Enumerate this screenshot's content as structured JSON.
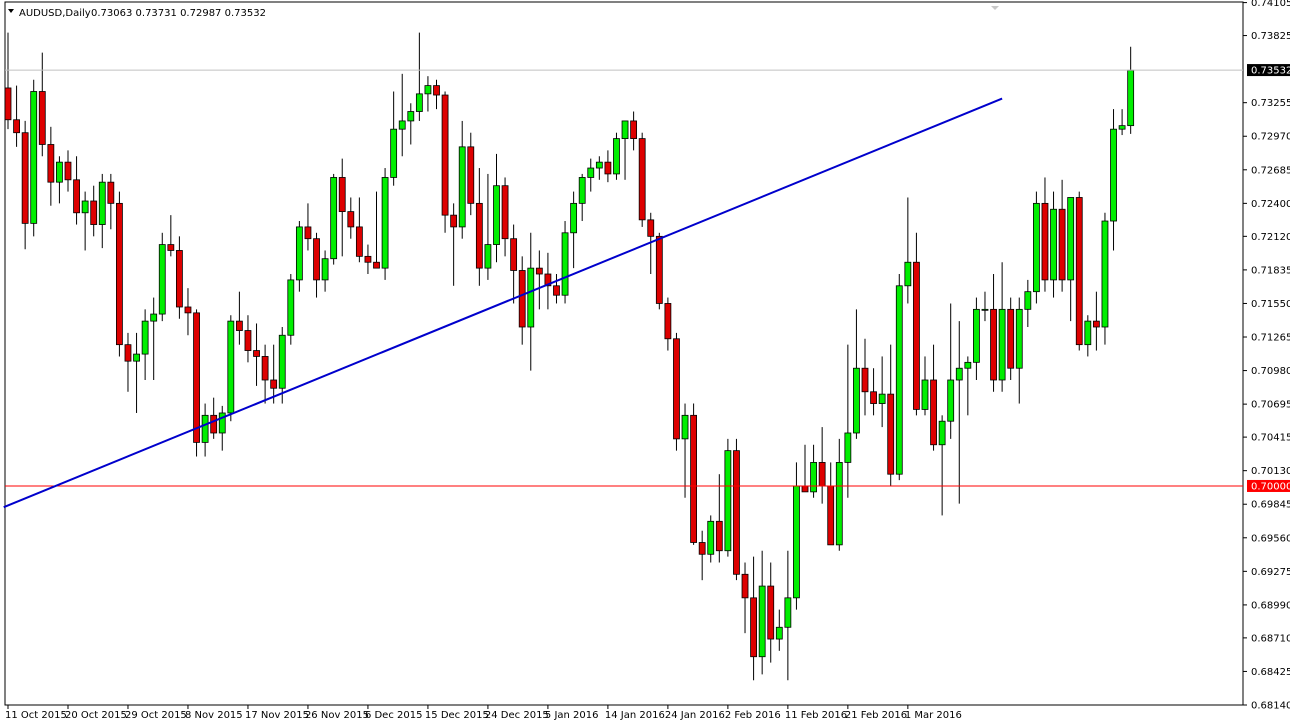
{
  "header": {
    "symbol_label": "AUDUSD,Daily",
    "ohlc_text": "0.73063 0.73731 0.72987 0.73532"
  },
  "colors": {
    "bull": "#00ee00",
    "bear": "#dd0000",
    "trendline": "#0000cc",
    "level_line": "#ff0000",
    "current_tag": "#000000"
  },
  "chart_data": {
    "type": "candlestick",
    "symbol": "AUDUSD",
    "timeframe": "Daily",
    "ylim": [
      0.6814,
      0.7411
    ],
    "y_ticks": [
      "0.74105",
      "0.73825",
      "0.73255",
      "0.72970",
      "0.72685",
      "0.72400",
      "0.72120",
      "0.71835",
      "0.71550",
      "0.71265",
      "0.70980",
      "0.70695",
      "0.70415",
      "0.70130",
      "0.69845",
      "0.69560",
      "0.69275",
      "0.68990",
      "0.68710",
      "0.68425",
      "0.68140"
    ],
    "x_labels": [
      {
        "label": "11 Oct 2015",
        "index": 0
      },
      {
        "label": "20 Oct 2015",
        "index": 7
      },
      {
        "label": "29 Oct 2015",
        "index": 14
      },
      {
        "label": "8 Nov 2015",
        "index": 21
      },
      {
        "label": "17 Nov 2015",
        "index": 28
      },
      {
        "label": "26 Nov 2015",
        "index": 35
      },
      {
        "label": "6 Dec 2015",
        "index": 42
      },
      {
        "label": "15 Dec 2015",
        "index": 49
      },
      {
        "label": "24 Dec 2015",
        "index": 56
      },
      {
        "label": "5 Jan 2016",
        "index": 63
      },
      {
        "label": "14 Jan 2016",
        "index": 70
      },
      {
        "label": "24 Jan 2016",
        "index": 77
      },
      {
        "label": "2 Feb 2016",
        "index": 84
      },
      {
        "label": "11 Feb 2016",
        "index": 91
      },
      {
        "label": "21 Feb 2016",
        "index": 98
      },
      {
        "label": "1 Mar 2016",
        "index": 105
      }
    ],
    "current_price": {
      "value": 0.73532,
      "label": "0.73532"
    },
    "horizontal_level": {
      "value": 0.7,
      "label": "0.70000"
    },
    "trendline": {
      "from": {
        "index": -0.5,
        "price": 0.6982
      },
      "to": {
        "index": 116,
        "price": 0.7329
      }
    },
    "candles": [
      [
        0.7338,
        0.7385,
        0.7303,
        0.7311
      ],
      [
        0.7311,
        0.734,
        0.7288,
        0.73
      ],
      [
        0.73,
        0.731,
        0.7201,
        0.7223
      ],
      [
        0.7223,
        0.7345,
        0.7212,
        0.7335
      ],
      [
        0.7335,
        0.7368,
        0.728,
        0.729
      ],
      [
        0.729,
        0.7305,
        0.7238,
        0.7258
      ],
      [
        0.7258,
        0.728,
        0.724,
        0.7275
      ],
      [
        0.7275,
        0.7285,
        0.725,
        0.726
      ],
      [
        0.726,
        0.728,
        0.7222,
        0.7232
      ],
      [
        0.7232,
        0.725,
        0.72,
        0.7242
      ],
      [
        0.7242,
        0.7255,
        0.7212,
        0.7222
      ],
      [
        0.7222,
        0.7265,
        0.7202,
        0.7258
      ],
      [
        0.7258,
        0.7265,
        0.7218,
        0.724
      ],
      [
        0.724,
        0.725,
        0.711,
        0.712
      ],
      [
        0.712,
        0.713,
        0.708,
        0.7106
      ],
      [
        0.7106,
        0.713,
        0.7062,
        0.7112
      ],
      [
        0.7112,
        0.715,
        0.709,
        0.714
      ],
      [
        0.714,
        0.716,
        0.709,
        0.7146
      ],
      [
        0.7146,
        0.7215,
        0.714,
        0.7205
      ],
      [
        0.7205,
        0.723,
        0.7195,
        0.72
      ],
      [
        0.72,
        0.7212,
        0.7142,
        0.7152
      ],
      [
        0.7152,
        0.7168,
        0.7128,
        0.7147
      ],
      [
        0.7147,
        0.715,
        0.7025,
        0.7037
      ],
      [
        0.7037,
        0.707,
        0.7025,
        0.706
      ],
      [
        0.706,
        0.7075,
        0.704,
        0.7045
      ],
      [
        0.7045,
        0.7068,
        0.703,
        0.7062
      ],
      [
        0.7062,
        0.7145,
        0.7055,
        0.714
      ],
      [
        0.714,
        0.7165,
        0.712,
        0.7132
      ],
      [
        0.7132,
        0.7145,
        0.7105,
        0.7115
      ],
      [
        0.7115,
        0.7138,
        0.7085,
        0.711
      ],
      [
        0.711,
        0.712,
        0.707,
        0.709
      ],
      [
        0.709,
        0.712,
        0.707,
        0.7083
      ],
      [
        0.7083,
        0.7135,
        0.707,
        0.7128
      ],
      [
        0.7128,
        0.718,
        0.712,
        0.7175
      ],
      [
        0.7175,
        0.7225,
        0.7165,
        0.722
      ],
      [
        0.722,
        0.724,
        0.72,
        0.721
      ],
      [
        0.721,
        0.7215,
        0.716,
        0.7175
      ],
      [
        0.7175,
        0.72,
        0.7165,
        0.7193
      ],
      [
        0.7193,
        0.7265,
        0.7188,
        0.7262
      ],
      [
        0.7262,
        0.7278,
        0.7195,
        0.7233
      ],
      [
        0.7233,
        0.7245,
        0.721,
        0.722
      ],
      [
        0.722,
        0.7245,
        0.719,
        0.7195
      ],
      [
        0.7195,
        0.7205,
        0.718,
        0.719
      ],
      [
        0.719,
        0.725,
        0.7185,
        0.7185
      ],
      [
        0.7185,
        0.727,
        0.7175,
        0.7262
      ],
      [
        0.7262,
        0.7335,
        0.7255,
        0.7303
      ],
      [
        0.7303,
        0.735,
        0.728,
        0.731
      ],
      [
        0.731,
        0.7325,
        0.729,
        0.7318
      ],
      [
        0.7318,
        0.7385,
        0.731,
        0.7333
      ],
      [
        0.7333,
        0.7348,
        0.7318,
        0.734
      ],
      [
        0.734,
        0.7345,
        0.732,
        0.7332
      ],
      [
        0.7332,
        0.7335,
        0.7215,
        0.723
      ],
      [
        0.723,
        0.724,
        0.717,
        0.722
      ],
      [
        0.722,
        0.731,
        0.721,
        0.7288
      ],
      [
        0.7288,
        0.73,
        0.723,
        0.724
      ],
      [
        0.724,
        0.727,
        0.717,
        0.7185
      ],
      [
        0.7185,
        0.7265,
        0.7175,
        0.7205
      ],
      [
        0.7205,
        0.7282,
        0.719,
        0.7255
      ],
      [
        0.7255,
        0.7262,
        0.7195,
        0.721
      ],
      [
        0.721,
        0.7222,
        0.7155,
        0.7183
      ],
      [
        0.7183,
        0.7195,
        0.712,
        0.7135
      ],
      [
        0.7135,
        0.7215,
        0.7098,
        0.7185
      ],
      [
        0.7185,
        0.72,
        0.715,
        0.718
      ],
      [
        0.718,
        0.7198,
        0.715,
        0.717
      ],
      [
        0.717,
        0.718,
        0.7155,
        0.7162
      ]
    ],
    "candles2": [
      [
        0.7162,
        0.7225,
        0.7155,
        0.7215
      ],
      [
        0.7215,
        0.725,
        0.7185,
        0.724
      ],
      [
        0.724,
        0.7265,
        0.7225,
        0.7262
      ],
      [
        0.7262,
        0.7278,
        0.725,
        0.727
      ],
      [
        0.727,
        0.728,
        0.726,
        0.7275
      ],
      [
        0.7275,
        0.7285,
        0.7258,
        0.7265
      ],
      [
        0.7265,
        0.73,
        0.726,
        0.7295
      ],
      [
        0.7295,
        0.7308,
        0.726,
        0.731
      ],
      [
        0.731,
        0.7318,
        0.7285,
        0.7295
      ],
      [
        0.7295,
        0.73,
        0.722,
        0.7226
      ],
      [
        0.7226,
        0.7232,
        0.718,
        0.7212
      ],
      [
        0.7212,
        0.7215,
        0.715,
        0.7155
      ],
      [
        0.7155,
        0.716,
        0.7115,
        0.7125
      ],
      [
        0.7125,
        0.713,
        0.703,
        0.704
      ],
      [
        0.704,
        0.707,
        0.699,
        0.706
      ],
      [
        0.706,
        0.707,
        0.695,
        0.6952
      ],
      [
        0.6952,
        0.6962,
        0.692,
        0.6942
      ],
      [
        0.6942,
        0.6975,
        0.6935,
        0.697
      ],
      [
        0.697,
        0.701,
        0.6935,
        0.6945
      ],
      [
        0.6945,
        0.704,
        0.694,
        0.703
      ],
      [
        0.703,
        0.704,
        0.692,
        0.6925
      ],
      [
        0.6925,
        0.6935,
        0.6875,
        0.6905
      ],
      [
        0.6905,
        0.694,
        0.6835,
        0.6855
      ],
      [
        0.6855,
        0.6945,
        0.684,
        0.6915
      ],
      [
        0.6915,
        0.6935,
        0.685,
        0.687
      ],
      [
        0.687,
        0.6895,
        0.686,
        0.688
      ],
      [
        0.688,
        0.6945,
        0.6835,
        0.6905
      ],
      [
        0.6905,
        0.702,
        0.6895,
        0.7
      ],
      [
        0.7,
        0.7035,
        0.6995,
        0.6995
      ],
      [
        0.6995,
        0.7035,
        0.699,
        0.702
      ],
      [
        0.702,
        0.705,
        0.6985,
        0.7
      ],
      [
        0.7,
        0.702,
        0.695,
        0.695
      ],
      [
        0.695,
        0.704,
        0.6945,
        0.702
      ],
      [
        0.702,
        0.712,
        0.699,
        0.7045
      ],
      [
        0.7045,
        0.715,
        0.704,
        0.71
      ],
      [
        0.71,
        0.7125,
        0.706,
        0.708
      ],
      [
        0.708,
        0.71,
        0.706,
        0.707
      ],
      [
        0.707,
        0.711,
        0.705,
        0.7078
      ],
      [
        0.7078,
        0.712,
        0.7,
        0.701
      ],
      [
        0.701,
        0.718,
        0.7005,
        0.717
      ],
      [
        0.717,
        0.7245,
        0.7155,
        0.719
      ],
      [
        0.719,
        0.7215,
        0.706,
        0.7065
      ],
      [
        0.7065,
        0.711,
        0.706,
        0.709
      ],
      [
        0.709,
        0.712,
        0.703,
        0.7035
      ],
      [
        0.7035,
        0.706,
        0.6975,
        0.7055
      ],
      [
        0.7055,
        0.7155,
        0.704,
        0.709
      ],
      [
        0.709,
        0.714,
        0.6985,
        0.71
      ],
      [
        0.71,
        0.711,
        0.706,
        0.7105
      ],
      [
        0.7105,
        0.716,
        0.709,
        0.715
      ],
      [
        0.715,
        0.7165,
        0.714,
        0.715
      ],
      [
        0.715,
        0.718,
        0.708,
        0.709
      ],
      [
        0.709,
        0.719,
        0.708,
        0.715
      ],
      [
        0.715,
        0.716,
        0.709,
        0.71
      ],
      [
        0.71,
        0.716,
        0.707,
        0.715
      ],
      [
        0.715,
        0.7175,
        0.7135,
        0.7165
      ],
      [
        0.7165,
        0.725,
        0.7155,
        0.724
      ],
      [
        0.724,
        0.7262,
        0.7165,
        0.7175
      ],
      [
        0.7175,
        0.725,
        0.716,
        0.7235
      ],
      [
        0.7235,
        0.726,
        0.7165,
        0.7175
      ],
      [
        0.7175,
        0.7245,
        0.714,
        0.7245
      ],
      [
        0.7245,
        0.725,
        0.7115,
        0.712
      ],
      [
        0.712,
        0.7145,
        0.711,
        0.714
      ],
      [
        0.714,
        0.7165,
        0.7115,
        0.7135
      ],
      [
        0.7135,
        0.7232,
        0.712,
        0.7225
      ],
      [
        0.7225,
        0.732,
        0.72,
        0.7303
      ],
      [
        0.7303,
        0.732,
        0.7298,
        0.7306
      ],
      [
        0.7306,
        0.7373,
        0.7299,
        0.7353
      ]
    ]
  }
}
